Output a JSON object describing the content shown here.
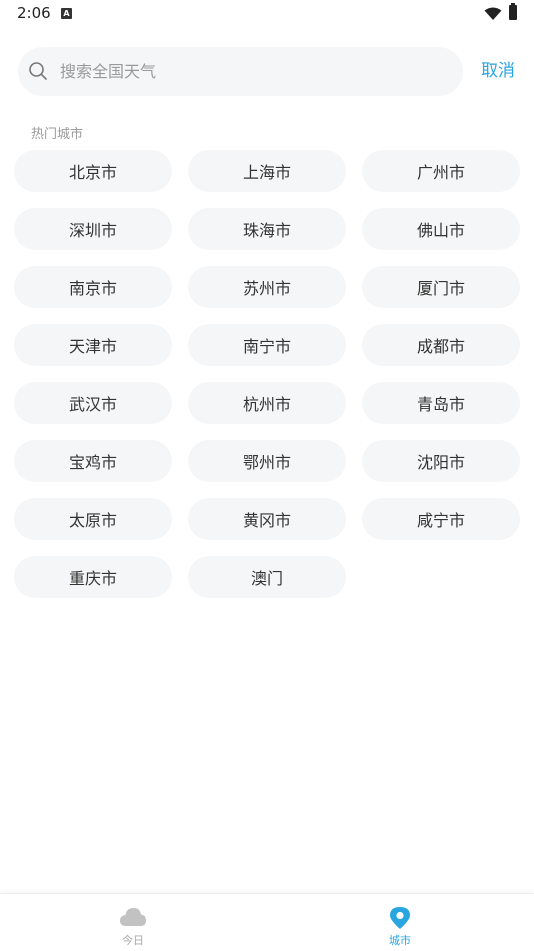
{
  "status_bar": {
    "time": "2:06",
    "notification_glyph": "A",
    "icons": [
      "wifi-icon",
      "battery-icon"
    ]
  },
  "search": {
    "placeholder": "搜索全国天气",
    "value": "",
    "icon": "search-icon",
    "cancel_label": "取消"
  },
  "hot_cities": {
    "label": "热门城市",
    "cities": [
      "北京市",
      "上海市",
      "广州市",
      "深圳市",
      "珠海市",
      "佛山市",
      "南京市",
      "苏州市",
      "厦门市",
      "天津市",
      "南宁市",
      "成都市",
      "武汉市",
      "杭州市",
      "青岛市",
      "宝鸡市",
      "鄂州市",
      "沈阳市",
      "太原市",
      "黄冈市",
      "咸宁市",
      "重庆市",
      "澳门"
    ]
  },
  "bottom_nav": {
    "items": [
      {
        "label": "今日",
        "icon": "cloud-icon",
        "active": false
      },
      {
        "label": "城市",
        "icon": "location-pin-icon",
        "active": true
      }
    ]
  },
  "colors": {
    "accent": "#29a6df",
    "chip_bg": "#f5f6f7",
    "inactive": "#aaaaaa"
  }
}
